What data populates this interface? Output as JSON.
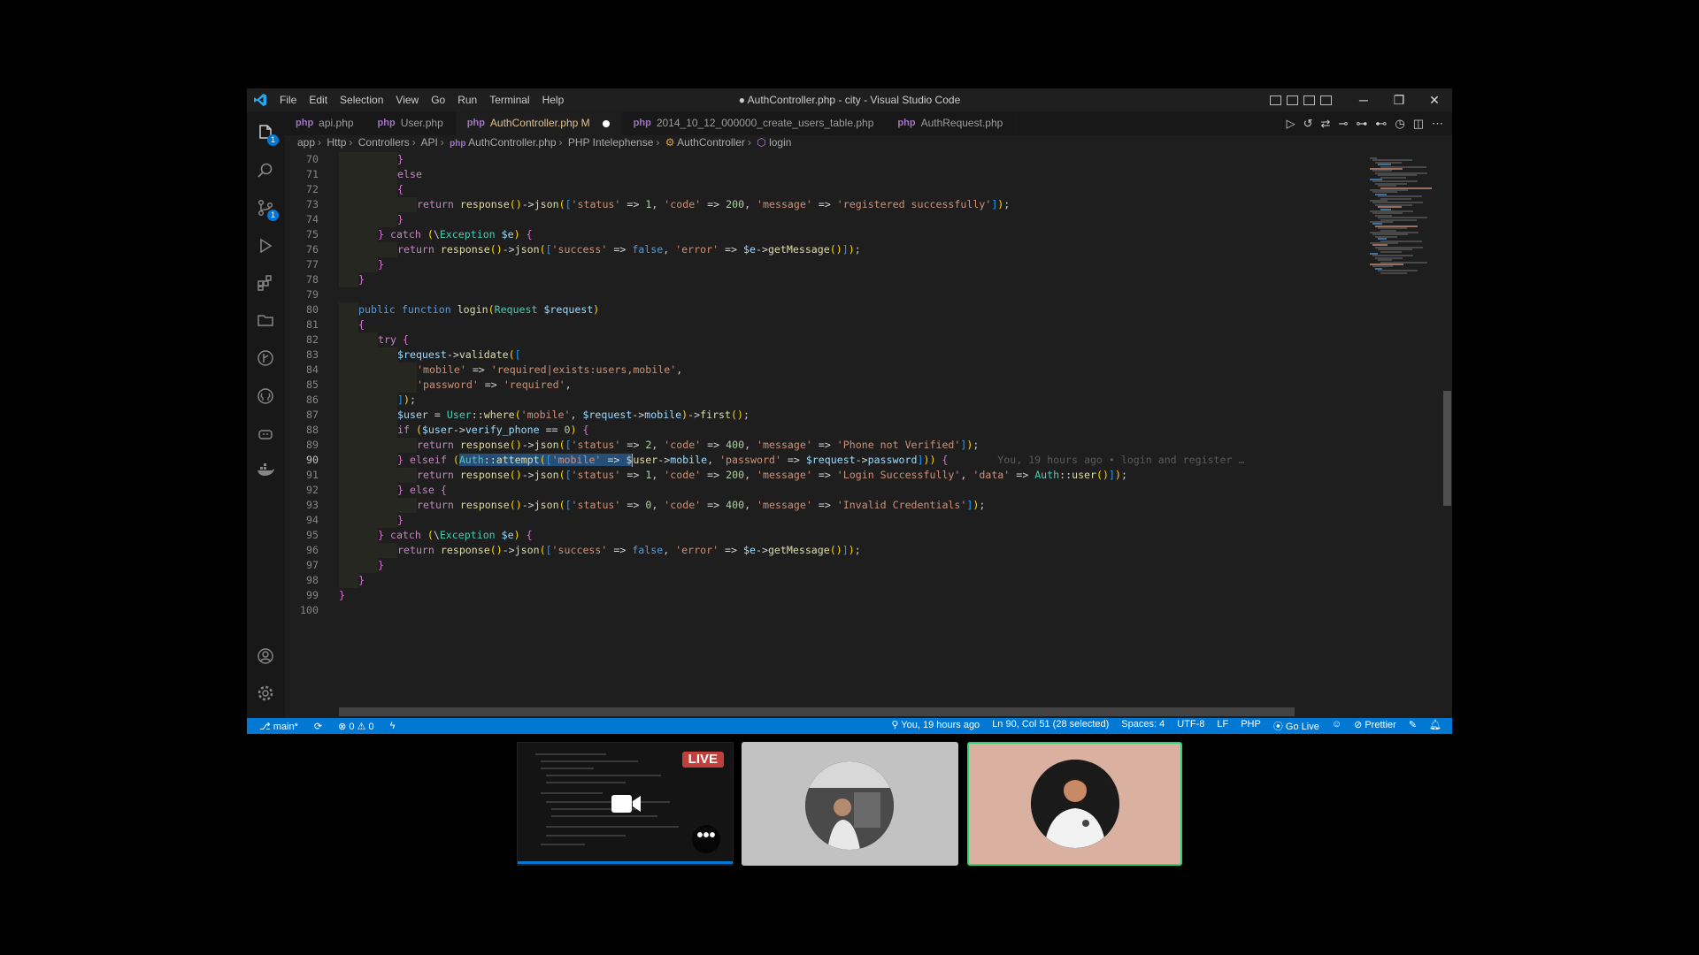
{
  "window": {
    "title": "● AuthController.php - city - Visual Studio Code",
    "menu": [
      "File",
      "Edit",
      "Selection",
      "View",
      "Go",
      "Run",
      "Terminal",
      "Help"
    ],
    "controls": [
      "─",
      "❐",
      "✕"
    ]
  },
  "activity_bar": {
    "explorer_badge": "1",
    "source_control_badge": "1"
  },
  "tabs": [
    {
      "label": "api.php",
      "active": false,
      "modified": false
    },
    {
      "label": "User.php",
      "active": false,
      "modified": false
    },
    {
      "label": "AuthController.php M",
      "active": true,
      "modified": true
    },
    {
      "label": "2014_10_12_000000_create_users_table.php",
      "active": false,
      "modified": false
    },
    {
      "label": "AuthRequest.php",
      "active": false,
      "modified": false
    }
  ],
  "tab_icon_label": "php",
  "breadcrumb": [
    "app",
    "Http",
    "Controllers",
    "API",
    "AuthController.php",
    "PHP Intelephense",
    "AuthController",
    "login"
  ],
  "editor": {
    "current_line": 90,
    "blame": "You, 19 hours ago • login and register …",
    "lines": [
      {
        "n": "70",
        "indent": 3,
        "text": "}"
      },
      {
        "n": "71",
        "indent": 3,
        "text": "else"
      },
      {
        "n": "72",
        "indent": 3,
        "text": "{"
      },
      {
        "n": "73",
        "indent": 4,
        "text": "return response()->json(['status' => 1, 'code' => 200, 'message' => 'registered successfully']);"
      },
      {
        "n": "74",
        "indent": 3,
        "text": "}"
      },
      {
        "n": "75",
        "indent": 2,
        "text": "} catch (\\Exception $e) {"
      },
      {
        "n": "76",
        "indent": 3,
        "text": "return response()->json(['success' => false, 'error' => $e->getMessage()]);"
      },
      {
        "n": "77",
        "indent": 2,
        "text": "}"
      },
      {
        "n": "78",
        "indent": 1,
        "text": "}"
      },
      {
        "n": "79",
        "indent": 0,
        "text": ""
      },
      {
        "n": "80",
        "indent": 1,
        "text": "public function login(Request $request)"
      },
      {
        "n": "81",
        "indent": 1,
        "text": "{"
      },
      {
        "n": "82",
        "indent": 2,
        "text": "try {"
      },
      {
        "n": "83",
        "indent": 3,
        "text": "$request->validate(["
      },
      {
        "n": "84",
        "indent": 4,
        "text": "'mobile' => 'required|exists:users,mobile',"
      },
      {
        "n": "85",
        "indent": 4,
        "text": "'password' => 'required',"
      },
      {
        "n": "86",
        "indent": 3,
        "text": "]);"
      },
      {
        "n": "87",
        "indent": 3,
        "text": "$user = User::where('mobile', $request->mobile)->first();"
      },
      {
        "n": "88",
        "indent": 3,
        "text": "if ($user->verify_phone == 0) {"
      },
      {
        "n": "89",
        "indent": 4,
        "text": "return response()->json(['status' => 2, 'code' => 400, 'message' => 'Phone not Verified']);"
      },
      {
        "n": "90",
        "indent": 3,
        "text": "} elseif (Auth::attempt(['mobile' => $user->mobile, 'password' => $request->password])) {"
      },
      {
        "n": "91",
        "indent": 4,
        "text": "return response()->json(['status' => 1, 'code' => 200, 'message' => 'Login Successfully', 'data' => Auth::user()]);"
      },
      {
        "n": "92",
        "indent": 3,
        "text": "} else {"
      },
      {
        "n": "93",
        "indent": 4,
        "text": "return response()->json(['status' => 0, 'code' => 400, 'message' => 'Invalid Credentials']);"
      },
      {
        "n": "94",
        "indent": 3,
        "text": "}"
      },
      {
        "n": "95",
        "indent": 2,
        "text": "} catch (\\Exception $e) {"
      },
      {
        "n": "96",
        "indent": 3,
        "text": "return response()->json(['success' => false, 'error' => $e->getMessage()]);"
      },
      {
        "n": "97",
        "indent": 2,
        "text": "}"
      },
      {
        "n": "98",
        "indent": 1,
        "text": "}"
      },
      {
        "n": "99",
        "indent": 0,
        "text": "}"
      },
      {
        "n": "100",
        "indent": 0,
        "text": ""
      }
    ]
  },
  "status_bar": {
    "branch": "main*",
    "errors": "0",
    "warnings": "0",
    "blame": "You, 19 hours ago",
    "cursor": "Ln 90, Col 51 (28 selected)",
    "spaces": "Spaces: 4",
    "encoding": "UTF-8",
    "eol": "LF",
    "language": "PHP",
    "go_live": "Go Live",
    "prettier": "Prettier"
  },
  "call": {
    "live_badge": "LIVE",
    "more_label": "•••"
  },
  "colors": {
    "status_bar": "#0078d4",
    "editor_bg": "#1e1e1e",
    "active_speaker_border": "#2dd36f",
    "live_badge": "#c2403c"
  }
}
